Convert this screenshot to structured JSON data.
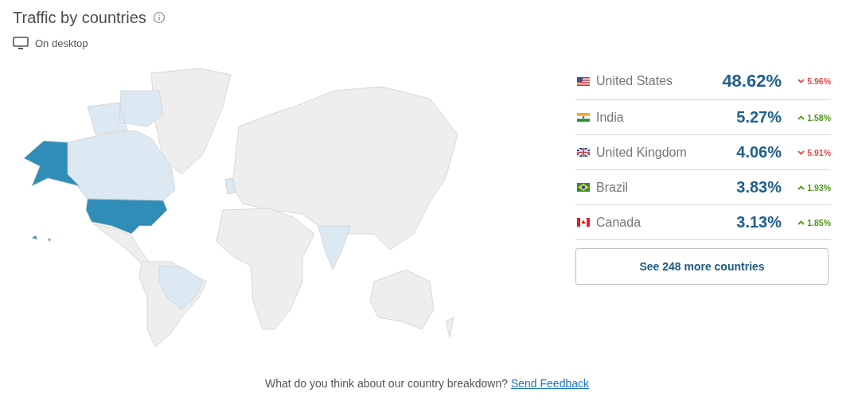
{
  "title": "Traffic by countries",
  "device": "On desktop",
  "countries": [
    {
      "name": "United States",
      "share": "48.62%",
      "change": "5.96%",
      "rising": false
    },
    {
      "name": "India",
      "share": "5.27%",
      "change": "1.58%",
      "rising": true
    },
    {
      "name": "United Kingdom",
      "share": "4.06%",
      "change": "5.91%",
      "rising": false
    },
    {
      "name": "Brazil",
      "share": "3.83%",
      "change": "1.93%",
      "rising": true
    },
    {
      "name": "Canada",
      "share": "3.13%",
      "change": "1.85%",
      "rising": true
    }
  ],
  "more_button": "See 248 more countries",
  "feedback": {
    "question": "What do you think about our country breakdown?",
    "link": "Send Feedback"
  }
}
